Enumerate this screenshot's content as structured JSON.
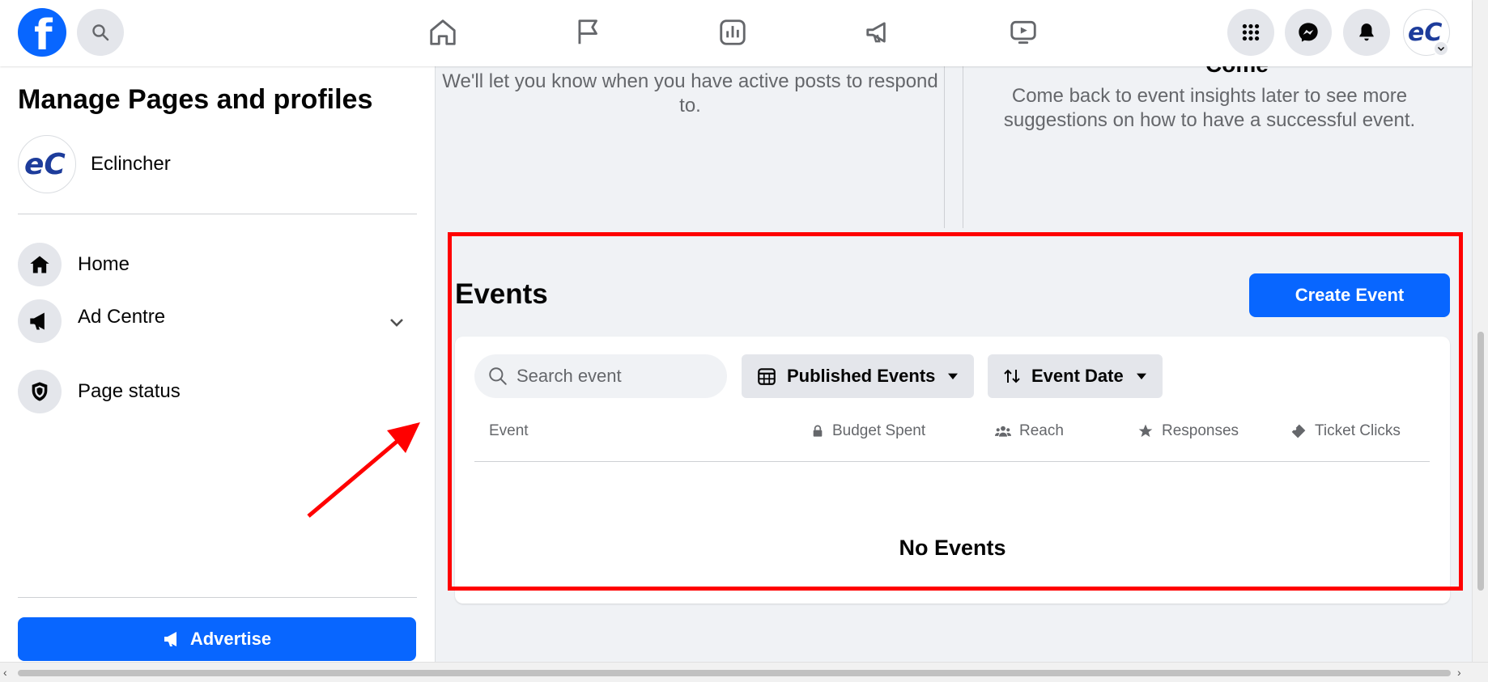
{
  "topbar": {
    "logo": "f",
    "icons": [
      "search-icon",
      "home-icon",
      "flag-icon",
      "insights-icon",
      "megaphone-icon",
      "video-icon",
      "menu-grid-icon",
      "messenger-icon",
      "bell-icon"
    ],
    "avatar_initials": "eC"
  },
  "sidebar": {
    "title": "Manage Pages and profiles",
    "profile": {
      "name": "Eclincher",
      "initials": "eC"
    },
    "items": [
      {
        "label": "Home",
        "icon": "home-icon"
      },
      {
        "label": "Ad Centre",
        "icon": "megaphone-icon"
      },
      {
        "label": "Page status",
        "icon": "shield-icon"
      }
    ],
    "advertise_label": "Advertise"
  },
  "main": {
    "left_card_text": "We'll let you know when you have active posts to respond to.",
    "right_card_heading": "Come",
    "right_card_text": "Come back to event insights later to see more suggestions on how to have a successful event.",
    "events": {
      "title": "Events",
      "create_label": "Create Event",
      "search_placeholder": "Search event",
      "filter_published": "Published Events",
      "filter_date": "Event Date",
      "columns": [
        "Event",
        "Budget Spent",
        "Reach",
        "Responses",
        "Ticket Clicks"
      ],
      "empty_text": "No Events"
    }
  },
  "colors": {
    "accent": "#0866ff",
    "annotation": "#ff0000"
  }
}
